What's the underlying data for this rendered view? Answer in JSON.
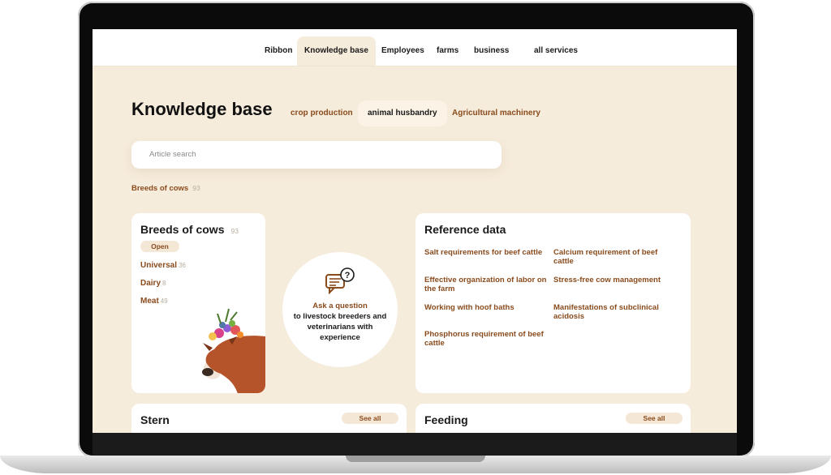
{
  "nav": {
    "items": [
      {
        "label": "Ribbon"
      },
      {
        "label": "Knowledge base",
        "active": true
      },
      {
        "label": "Employees"
      },
      {
        "label": "farms"
      },
      {
        "label": "business"
      },
      {
        "label": "all services"
      }
    ]
  },
  "header": {
    "title": "Knowledge base",
    "tabs": [
      {
        "label": "crop production"
      },
      {
        "label": "animal husbandry",
        "active": true
      },
      {
        "label": "Agricultural machinery"
      }
    ]
  },
  "search": {
    "placeholder": "Article search"
  },
  "breadcrumb": {
    "label": "Breeds of cows",
    "count": "93"
  },
  "breeds_card": {
    "title": "Breeds of cows",
    "count": "93",
    "open_label": "Open",
    "items": [
      {
        "label": "Universal",
        "count": "36"
      },
      {
        "label": "Dairy",
        "count": "8"
      },
      {
        "label": "Meat",
        "count": "49"
      }
    ],
    "image_icon": "cow-with-flower-crown"
  },
  "ask": {
    "icon": "chat-question-icon",
    "line1": "Ask a question",
    "line2": "to livestock breeders and veterinarians with experience"
  },
  "reference": {
    "title": "Reference data",
    "links": [
      "Salt requirements for beef cattle",
      "Calcium requirement of beef cattle",
      "Effective organization of labor on the farm",
      "Stress-free cow management",
      "Working with hoof baths",
      "Manifestations of subclinical acidosis",
      "Phosphorus requirement of beef cattle"
    ]
  },
  "sections": [
    {
      "title": "Stern",
      "see_all": "See all"
    },
    {
      "title": "Feeding",
      "see_all": "See all"
    }
  ],
  "colors": {
    "accent": "#8a4b1d",
    "background": "#f6ecdc",
    "card": "#ffffff"
  }
}
